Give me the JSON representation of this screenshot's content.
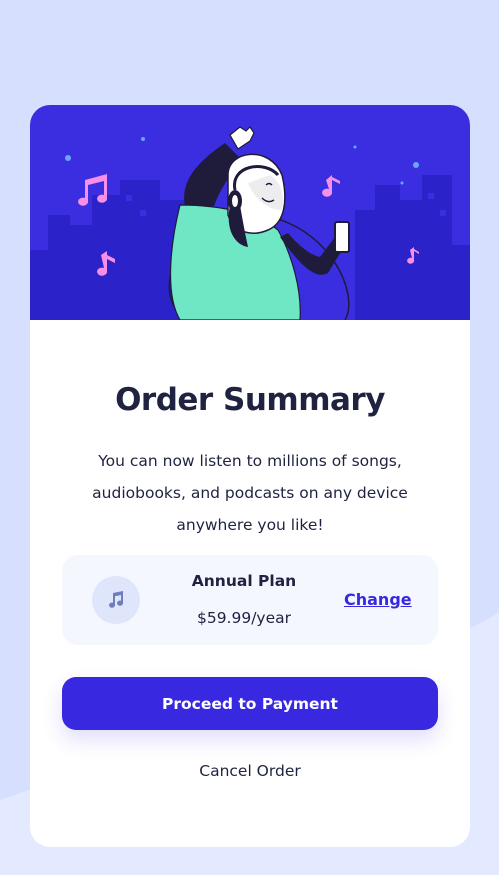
{
  "colors": {
    "page_background": "#d6e0fe",
    "hero_background": "#3a2ee0",
    "accent": "#3829e0",
    "text": "#1f2340",
    "plan_background": "#f5f7ff"
  },
  "hero": {
    "illustration": "person-dancing-with-headphones-illustration"
  },
  "summary": {
    "title": "Order Summary",
    "description": "You can now listen to millions of songs, audiobooks, and podcasts on any device anywhere you like!"
  },
  "plan": {
    "icon": "music-note-icon",
    "name": "Annual Plan",
    "price": "$59.99/year",
    "change_label": "Change"
  },
  "actions": {
    "proceed_label": "Proceed to Payment",
    "cancel_label": "Cancel Order"
  }
}
